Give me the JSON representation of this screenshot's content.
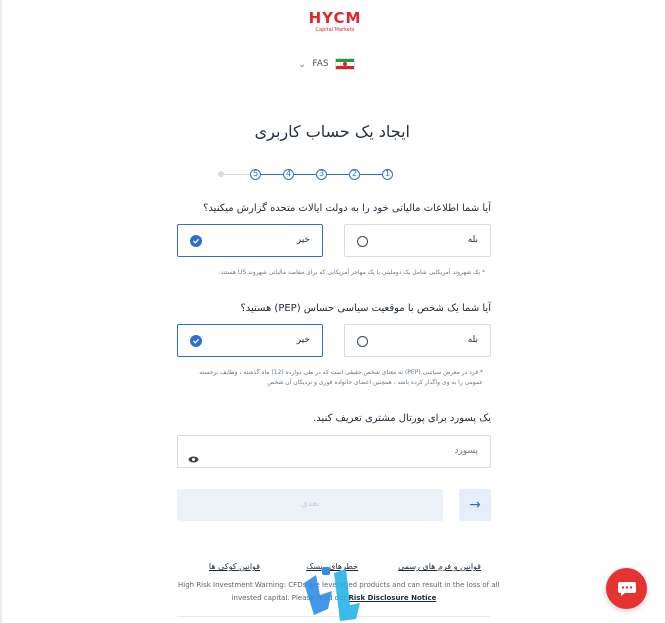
{
  "brand": {
    "logo_text": "HYCM",
    "logo_sub": "Capital Markets",
    "color": "#e1262d"
  },
  "language": {
    "code": "FAS",
    "flag": "iran-flag-icon"
  },
  "page_title": "ایجاد یک حساب کاربری",
  "steps": [
    "1",
    "2",
    "3",
    "4",
    "5"
  ],
  "accent_color": "#2e6fd6",
  "question1": {
    "text": "آیا شما اطلاعات مالیاتی خود را به دولت ایالات متحده گزارش میکنید؟",
    "options": [
      {
        "label": "بله",
        "selected": false
      },
      {
        "label": "خیر",
        "selected": true
      }
    ],
    "note": "* یک شهروند آمریکایی شامل یک دوملیتی یا یک مهاجر آمریکایی که برای مقاصد مالیاتی شهروند US هستند."
  },
  "question2": {
    "text": "آیا شما یک شخص با موقعیت سیاسی حساس (PEP) هستید؟",
    "options": [
      {
        "label": "بله",
        "selected": false
      },
      {
        "label": "خیر",
        "selected": true
      }
    ],
    "note_line1": "* فرد در معرض سیاسی (PEP) به معنای شخص حقیقی است که در طی دوازده (12) ماه گذشته ، وظایف برجسته",
    "note_line2": "عمومی را به وی واگذار کرده باشد ، همچنین اعضای خانواده فوری و نزدیکان آن شخص"
  },
  "password": {
    "prompt": "یک پسورد برای پورتال مشتری تعریف کنید.",
    "placeholder": "پسورد"
  },
  "submit_label": "بعدی",
  "footer": {
    "links": [
      "قوانین و فرم های رسمی",
      "خطرهای ریسک",
      "قوانین کوکی ها"
    ],
    "risk_line1": "High Risk Investment Warning: CFDs are leveraged products and can result in the loss of all",
    "risk_line2_pre": "invested capital. Please read our",
    "risk_link": "Risk Disclosure Notice"
  }
}
